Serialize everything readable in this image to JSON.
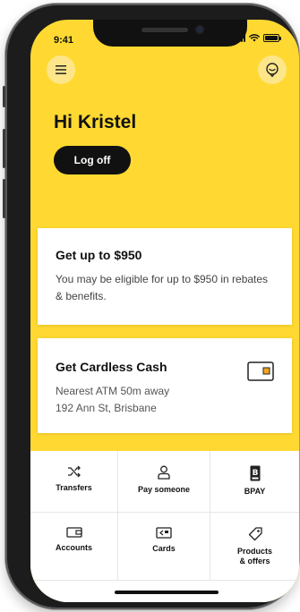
{
  "status_bar": {
    "time": "9:41"
  },
  "header": {
    "menu_icon": "hamburger-menu-icon",
    "chat_icon": "chat-assistant-icon"
  },
  "greeting": {
    "text": "Hi Kristel"
  },
  "logoff_button": {
    "label": "Log off"
  },
  "rebates_card": {
    "title": "Get up to $950",
    "text": "You may be eligible for up to $950 in rebates & benefits."
  },
  "cardless_card": {
    "title": "Get Cardless Cash",
    "line1": "Nearest ATM 50m away",
    "line2": "192 Ann St, Brisbane",
    "icon": "wallet-card-icon"
  },
  "quick_actions": [
    {
      "label": "Transfers",
      "icon": "transfer-shuffle-icon"
    },
    {
      "label": "Pay someone",
      "icon": "person-icon"
    },
    {
      "label": "BPAY",
      "icon": "bpay-icon"
    },
    {
      "label": "Accounts",
      "icon": "accounts-wallet-icon"
    },
    {
      "label": "Cards",
      "icon": "cards-icon"
    },
    {
      "label": "Products\n& offers",
      "icon": "tag-icon"
    }
  ],
  "colors": {
    "brand_yellow": "#ffd931",
    "accent_orange": "#f5a623",
    "text_dark": "#111111"
  }
}
